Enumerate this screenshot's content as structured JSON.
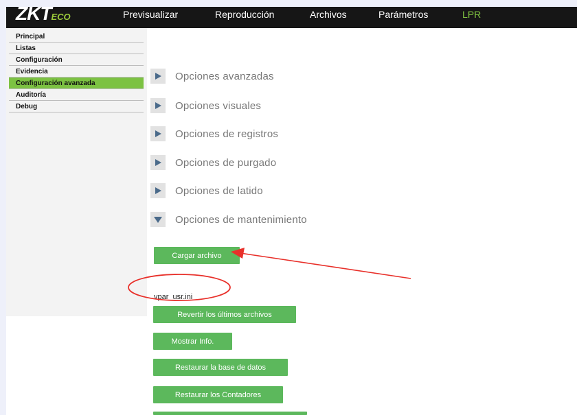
{
  "header": {
    "logo_main": "ZKT",
    "logo_sub": "ECO",
    "nav": [
      {
        "label": "Previsualizar",
        "active": false
      },
      {
        "label": "Reproducción",
        "active": false
      },
      {
        "label": "Archivos",
        "active": false
      },
      {
        "label": "Parámetros",
        "active": false
      },
      {
        "label": "LPR",
        "active": true
      }
    ],
    "accent_color": "#7fc241"
  },
  "sidebar": {
    "items": [
      {
        "label": "Principal",
        "active": false
      },
      {
        "label": "Listas",
        "active": false
      },
      {
        "label": "Configuración",
        "active": false
      },
      {
        "label": "Evidencia",
        "active": false
      },
      {
        "label": "Configuración avanzada",
        "active": true
      },
      {
        "label": "Auditoría",
        "active": false
      },
      {
        "label": "Debug",
        "active": false
      }
    ]
  },
  "sections": [
    {
      "label": "Opciones avanzadas",
      "expanded": false
    },
    {
      "label": "Opciones visuales",
      "expanded": false
    },
    {
      "label": "Opciones de registros",
      "expanded": false
    },
    {
      "label": "Opciones de purgado",
      "expanded": false
    },
    {
      "label": "Opciones de latido",
      "expanded": false
    },
    {
      "label": "Opciones de mantenimiento",
      "expanded": true
    }
  ],
  "maintenance": {
    "upload_button": "Cargar archivo",
    "selected_file": "vpar_usr.ini",
    "buttons": [
      "Revertir los últimos archivos",
      "Mostrar Info.",
      "Restaurar la base de datos",
      "Restaurar los Contadores"
    ],
    "button_color": "#5cb85c"
  },
  "annotation_color": "#e8302a"
}
